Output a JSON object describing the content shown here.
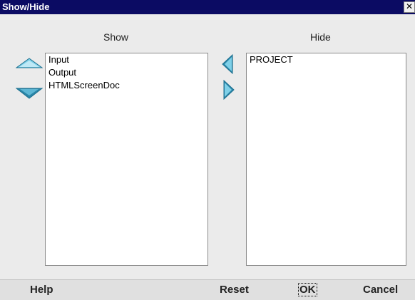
{
  "window": {
    "title": "Show/Hide",
    "close_glyph": "✕"
  },
  "show": {
    "label": "Show",
    "items": [
      "Input",
      "Output",
      "HTMLScreenDoc"
    ]
  },
  "hide": {
    "label": "Hide",
    "items": [
      "PROJECT"
    ]
  },
  "arrows": {
    "up": "arrow-up-icon",
    "down": "arrow-down-icon",
    "left": "arrow-left-icon",
    "right": "arrow-right-icon",
    "color_light": "#7fd0e8",
    "color_dark": "#1b6f8f"
  },
  "buttons": {
    "help": "Help",
    "reset": "Reset",
    "ok": "OK",
    "cancel": "Cancel"
  }
}
